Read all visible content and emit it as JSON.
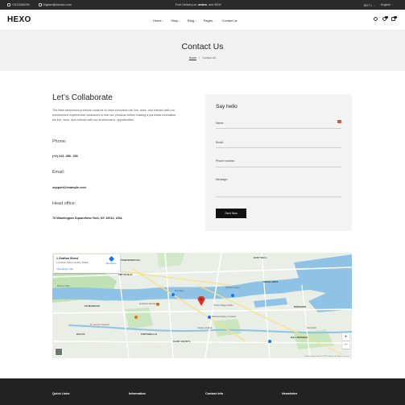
{
  "topbar": {
    "phone": "+0123456789",
    "email": "Digisen@domain.com",
    "promo_prefix": "Free Delivery on ",
    "promo_bold": "orders",
    "promo_suffix": " over $100",
    "currency": "BDT ৳",
    "language": "English"
  },
  "header": {
    "logo": "HEXO",
    "nav": [
      {
        "label": "Home",
        "caret": "⌄"
      },
      {
        "label": "Shop",
        "caret": "⌄"
      },
      {
        "label": "Blog",
        "caret": "⌄"
      },
      {
        "label": "Pages",
        "caret": "⌄"
      },
      {
        "label": "Contact us",
        "caret": ""
      }
    ],
    "wishlist_count": "0",
    "cart_count": "0"
  },
  "page_title": "Contact Us",
  "breadcrumb": {
    "home": "Home",
    "sep": "/",
    "current": "Contact Us"
  },
  "collab": {
    "heading": "Let’s Collaborate",
    "intro": "The Best electronics products continue to drive innovation we live, work, and interact with our environment experiences customers to test our products before making a purchase.innovation, we live, work, and interact with our environment. opportunities",
    "phone_label": "Phone:",
    "phone_value": "(+2) 123 -456 -789",
    "email_label": "Email:",
    "email_value": "support@example.com",
    "office_label": "Head office:",
    "office_value": "70 Washington SquareNew York, NY 10012, USA"
  },
  "form": {
    "title": "Say hello",
    "name_label": "Name:",
    "email_label": "Email:",
    "phone_label": "Phone number:",
    "message_label": "Message:",
    "submit_label": "Send Now"
  },
  "map": {
    "place_name": "1 Grafton Street",
    "place_address": "1 Grafton Street, Dublin, Dublin",
    "larger_map": "View larger map",
    "directions": "Directions",
    "zoom_in": "+",
    "zoom_out": "−",
    "attribution": "Keyboard shortcuts   Map data ©2024 Google   Terms   Report a map error",
    "labels": {
      "east_wall": "EAST WALL",
      "smithfield": "SMITHFIELD",
      "docklands": "DOCKLANDS",
      "portobello": "PORTOBELLO",
      "saint_kevins": "SAINT KEVIN'S",
      "phibsborough": "PHIBSBOROUGH",
      "ringsend": "RINGSEND",
      "kilmainham": "KILMAINHAM",
      "rialto": "RIALTO",
      "st_james": "St. James's Hospital",
      "trinity": "Trinity College Dublin",
      "national_gallery": "National Gallery of Ireland",
      "spire": "The Spire",
      "guinness": "Guinness Storehouse",
      "ballsbridge": "BALLSBRIDGE",
      "phoenix": "Phoenix Park",
      "pembroke": "Pembroke",
      "custom_house": "Custom House",
      "iveagh": "Iveagh Gardens"
    }
  },
  "footer": {
    "quick_links": "Quick Links",
    "information": "Information",
    "contact_info": "Contact Info",
    "newsletter": "Newsletter"
  },
  "colors": {
    "topbar_bg": "#2b2b2b",
    "title_band_bg": "#f2f2f2",
    "card_bg": "#f3f3f3",
    "button_bg": "#111111",
    "footer_bg": "#222222",
    "map_water": "#8fc3e6",
    "map_park": "#bfe2b4",
    "map_pin": "#d93025"
  }
}
